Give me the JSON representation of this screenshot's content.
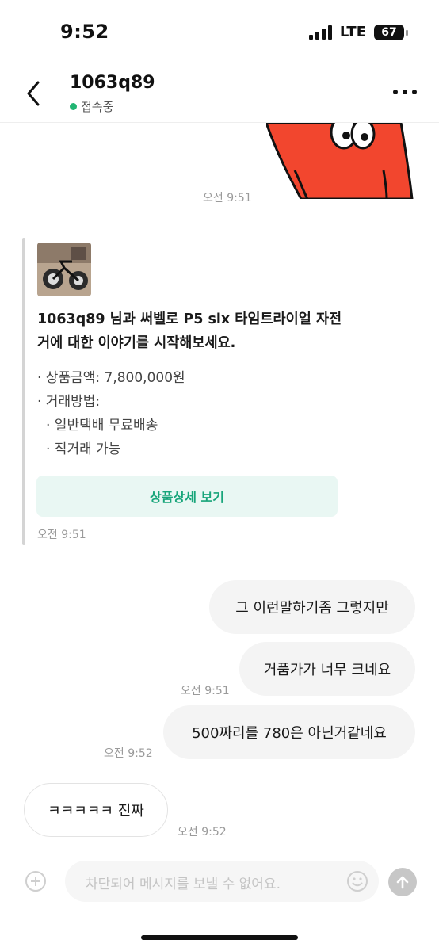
{
  "status_bar": {
    "time": "9:52",
    "network": "LTE",
    "battery": "67"
  },
  "header": {
    "title": "1063q89",
    "status": "접속중"
  },
  "messages": {
    "sticker_time": "오전 9:51",
    "product_card": {
      "intro": "1063q89 님과 써벨로 P5 six 타임트라이얼 자전거에 대한 이야기를 시작해보세요.",
      "price": "· 상품금액: 7,800,000원",
      "method_label": "· 거래방법:",
      "method_1": "· 일반택배 무료배송",
      "method_2": "· 직거래 가능",
      "button": "상품상세 보기",
      "time": "오전 9:51"
    },
    "outgoing": [
      {
        "text": "그 이런말하기좀 그렇지만"
      },
      {
        "text": "거품가가 너무 크네요",
        "time": "오전 9:51"
      },
      {
        "text": "500짜리를 780은 아닌거같네요",
        "time": "오전 9:52"
      }
    ],
    "incoming": [
      {
        "text": "ㅋㅋㅋㅋㅋ 진짜",
        "time": "오전 9:52"
      }
    ]
  },
  "input_bar": {
    "placeholder": "차단되어 메시지를 보낼 수 없어요."
  },
  "colors": {
    "accent": "#18a57a",
    "online": "#21b573",
    "sticker": "#f2462e"
  }
}
